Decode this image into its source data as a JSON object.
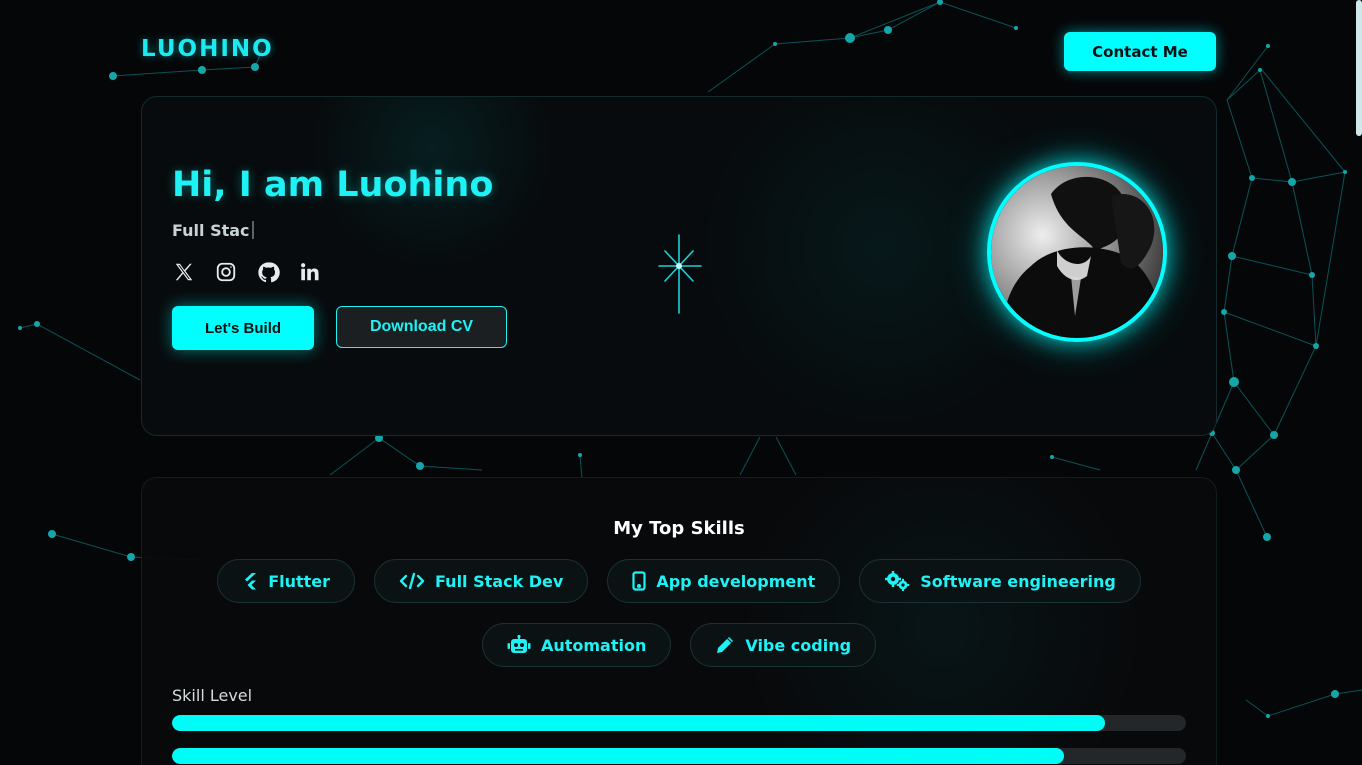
{
  "header": {
    "logo": "LUOHINO",
    "contact_label": "Contact Me"
  },
  "hero": {
    "title": "Hi, I am Luohino",
    "typed_role": "Full Stac",
    "socials": [
      {
        "icon": "x-twitter-icon"
      },
      {
        "icon": "instagram-icon"
      },
      {
        "icon": "github-icon"
      },
      {
        "icon": "linkedin-icon"
      }
    ],
    "primary_cta": "Let's Build",
    "secondary_cta": "Download CV"
  },
  "skills": {
    "title": "My Top Skills",
    "chips": [
      {
        "label": "Flutter",
        "icon": "flutter-icon"
      },
      {
        "label": "Full Stack Dev",
        "icon": "code-icon"
      },
      {
        "label": "App development",
        "icon": "mobile-icon"
      },
      {
        "label": "Software engineering",
        "icon": "gears-icon"
      },
      {
        "label": "Automation",
        "icon": "robot-icon"
      },
      {
        "label": "Vibe coding",
        "icon": "pencil-icon"
      }
    ],
    "skill_level_label": "Skill Level",
    "bars": [
      {
        "level": 0.92
      },
      {
        "level": 0.88
      }
    ]
  },
  "colors": {
    "accent": "#00ffff",
    "background": "#050608",
    "panel": "#080c0e"
  }
}
